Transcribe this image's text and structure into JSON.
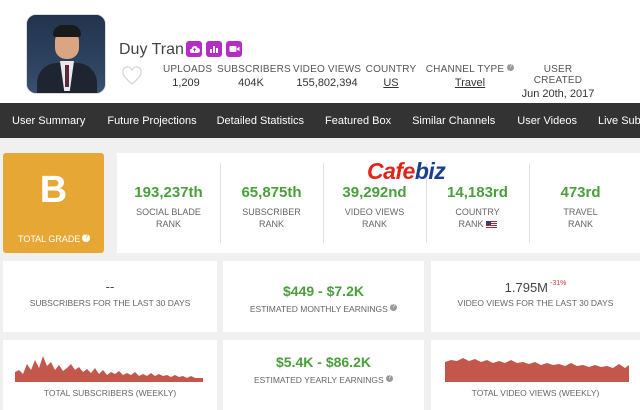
{
  "channel": {
    "name": "Duy Tran",
    "stats": [
      {
        "label": "UPLOADS",
        "value": "1,209"
      },
      {
        "label": "SUBSCRIBERS",
        "value": "404K"
      },
      {
        "label": "VIDEO VIEWS",
        "value": "155,802,394"
      },
      {
        "label": "COUNTRY",
        "value": "US"
      },
      {
        "label": "CHANNEL TYPE",
        "value": "Travel"
      },
      {
        "label": "USER CREATED",
        "value": "Jun 20th, 2017"
      }
    ]
  },
  "nav": [
    "User Summary",
    "Future Projections",
    "Detailed Statistics",
    "Featured Box",
    "Similar Channels",
    "User Videos",
    "Live Subscribe"
  ],
  "grade": {
    "letter": "B",
    "label": "TOTAL GRADE",
    "color": "#e7a734"
  },
  "ranks": [
    {
      "value": "193,237th",
      "label1": "SOCIAL BLADE",
      "label2": "RANK"
    },
    {
      "value": "65,875th",
      "label1": "SUBSCRIBER",
      "label2": "RANK"
    },
    {
      "value": "39,292nd",
      "label1": "VIDEO VIEWS",
      "label2": "RANK"
    },
    {
      "value": "14,183rd",
      "label1": "COUNTRY",
      "label2": "RANK"
    },
    {
      "value": "473rd",
      "label1": "TRAVEL",
      "label2": "RANK"
    }
  ],
  "watermark": {
    "part1": "Cafe",
    "part2": "biz"
  },
  "cards": {
    "subs30": {
      "value": "--",
      "caption": "SUBSCRIBERS FOR THE LAST 30 DAYS"
    },
    "monthly": {
      "value": "$449  -  $7.2K",
      "caption": "ESTIMATED MONTHLY EARNINGS"
    },
    "views30": {
      "value": "1.795M",
      "change": "-31%",
      "caption": "VIDEO VIEWS FOR THE LAST 30 DAYS"
    },
    "subsWeekly": {
      "caption": "TOTAL SUBSCRIBERS (WEEKLY)"
    },
    "yearly": {
      "value": "$5.4K  -  $86.2K",
      "caption": "ESTIMATED YEARLY EARNINGS"
    },
    "viewsWeekly": {
      "caption": "TOTAL VIDEO VIEWS (WEEKLY)"
    }
  },
  "colors": {
    "accent_green": "#4a9e3c",
    "icon_purple": "#b62dc6",
    "chart_fill": "#c4574b",
    "nav_bg": "#333333"
  }
}
